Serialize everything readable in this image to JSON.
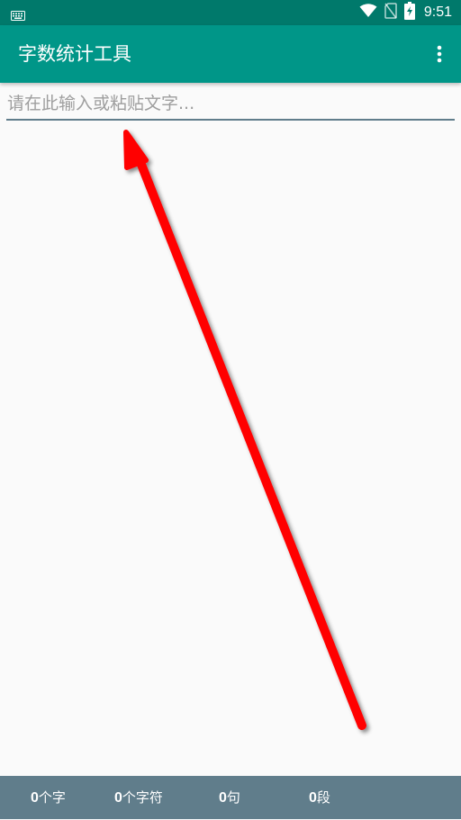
{
  "status_bar": {
    "time": "9:51",
    "icons": [
      "keyboard-icon",
      "wifi-icon",
      "no-sim-icon",
      "battery-charging-icon"
    ]
  },
  "app_bar": {
    "title": "字数统计工具",
    "menu_icon": "more-vert-icon"
  },
  "editor": {
    "value": "",
    "placeholder": "请在此输入或粘贴文字..."
  },
  "stats": {
    "chars": {
      "count": "0",
      "unit": "个字"
    },
    "characters": {
      "count": "0",
      "unit": "个字符"
    },
    "sentences": {
      "count": "0",
      "unit": "句"
    },
    "paragraphs": {
      "count": "0",
      "unit": "段"
    }
  },
  "colors": {
    "status_bar": "#00796B",
    "app_bar": "#009688",
    "bottom_bar": "#607D8B",
    "background": "#FAFAFA",
    "annotation_arrow": "#FF0000"
  }
}
